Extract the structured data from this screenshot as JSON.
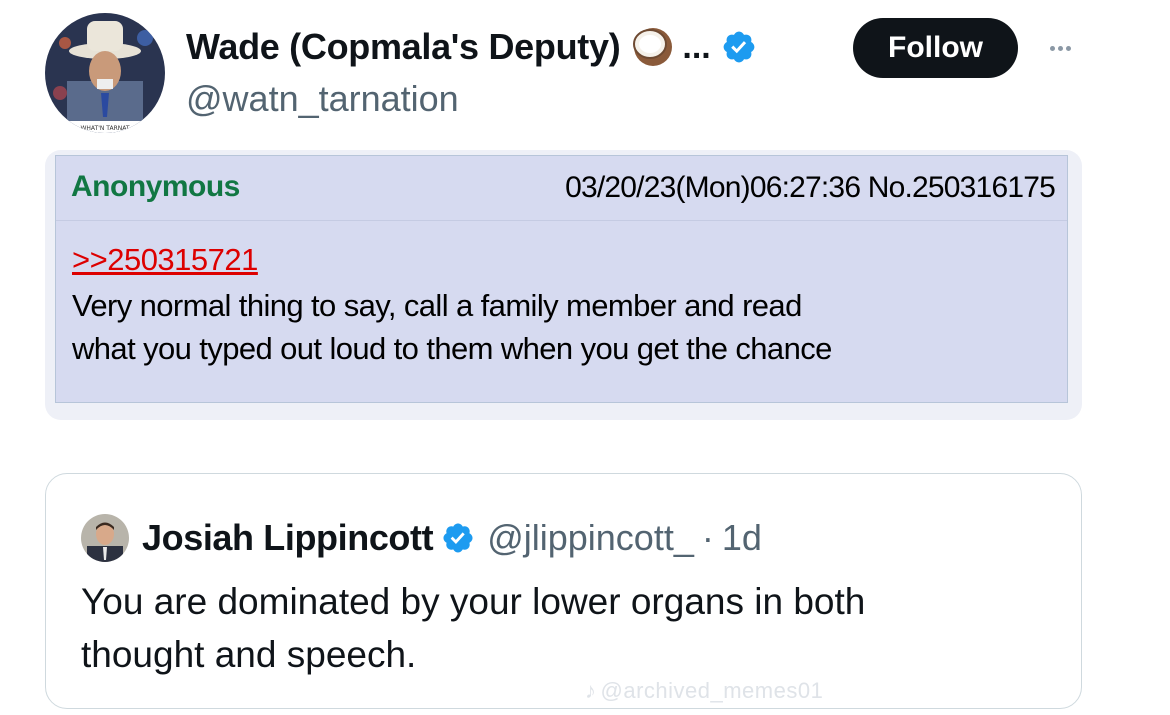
{
  "tweet": {
    "author": {
      "display_name": "Wade (Copmala's Deputy)",
      "emoji_icon": "coconut-icon",
      "truncation": "...",
      "verified_icon": "verified-badge-icon",
      "handle": "@watn_tarnation",
      "avatar_caption": "WHAT'N TARNAT"
    },
    "follow_label": "Follow",
    "more_icon": "more-options-icon"
  },
  "media": {
    "poster": "Anonymous",
    "post_meta": "03/20/23(Mon)06:27:36 No.250316175",
    "quote_link": ">>250315721",
    "body_lines": [
      "Very normal thing to say, call a family member and read",
      "what you typed out loud to them when you get the chance"
    ]
  },
  "quoted_tweet": {
    "display_name": "Josiah Lippincott",
    "verified_icon": "verified-badge-icon",
    "handle": "@jlippincott_",
    "separator": "·",
    "time": "1d",
    "text_lines": [
      "You are dominated by your lower organs in both",
      "thought and speech."
    ]
  },
  "watermark": "@archived_memes01",
  "colors": {
    "follow_bg": "#0f1419",
    "verified_blue": "#1d9bf0",
    "handle_gray": "#536471",
    "chan_post_bg": "#d6daf0",
    "chan_name_green": "#117743",
    "chan_quote_red": "#dd0000"
  }
}
